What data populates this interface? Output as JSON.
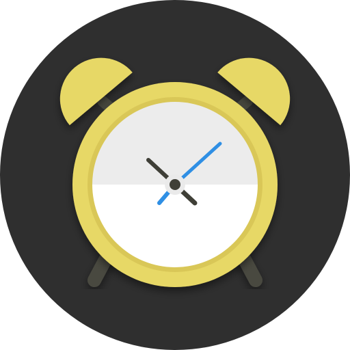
{
  "icon": {
    "name": "alarm-clock-icon",
    "colors": {
      "background_circle": "#2f2f2f",
      "bell": "#e7d866",
      "bell_shade": "#d8c652",
      "rim": "#e7d866",
      "rim_inner_shadow": "#d9c757",
      "dial_upper": "#ececec",
      "dial_lower": "#ffffff",
      "legs_and_stems": "#4a4a40",
      "hour_hand": "#3f3f37",
      "minute_hand": "#2f8fe4",
      "center_pin_outer": "#eaeaea",
      "center_pin_inner": "#3f3f37"
    }
  }
}
